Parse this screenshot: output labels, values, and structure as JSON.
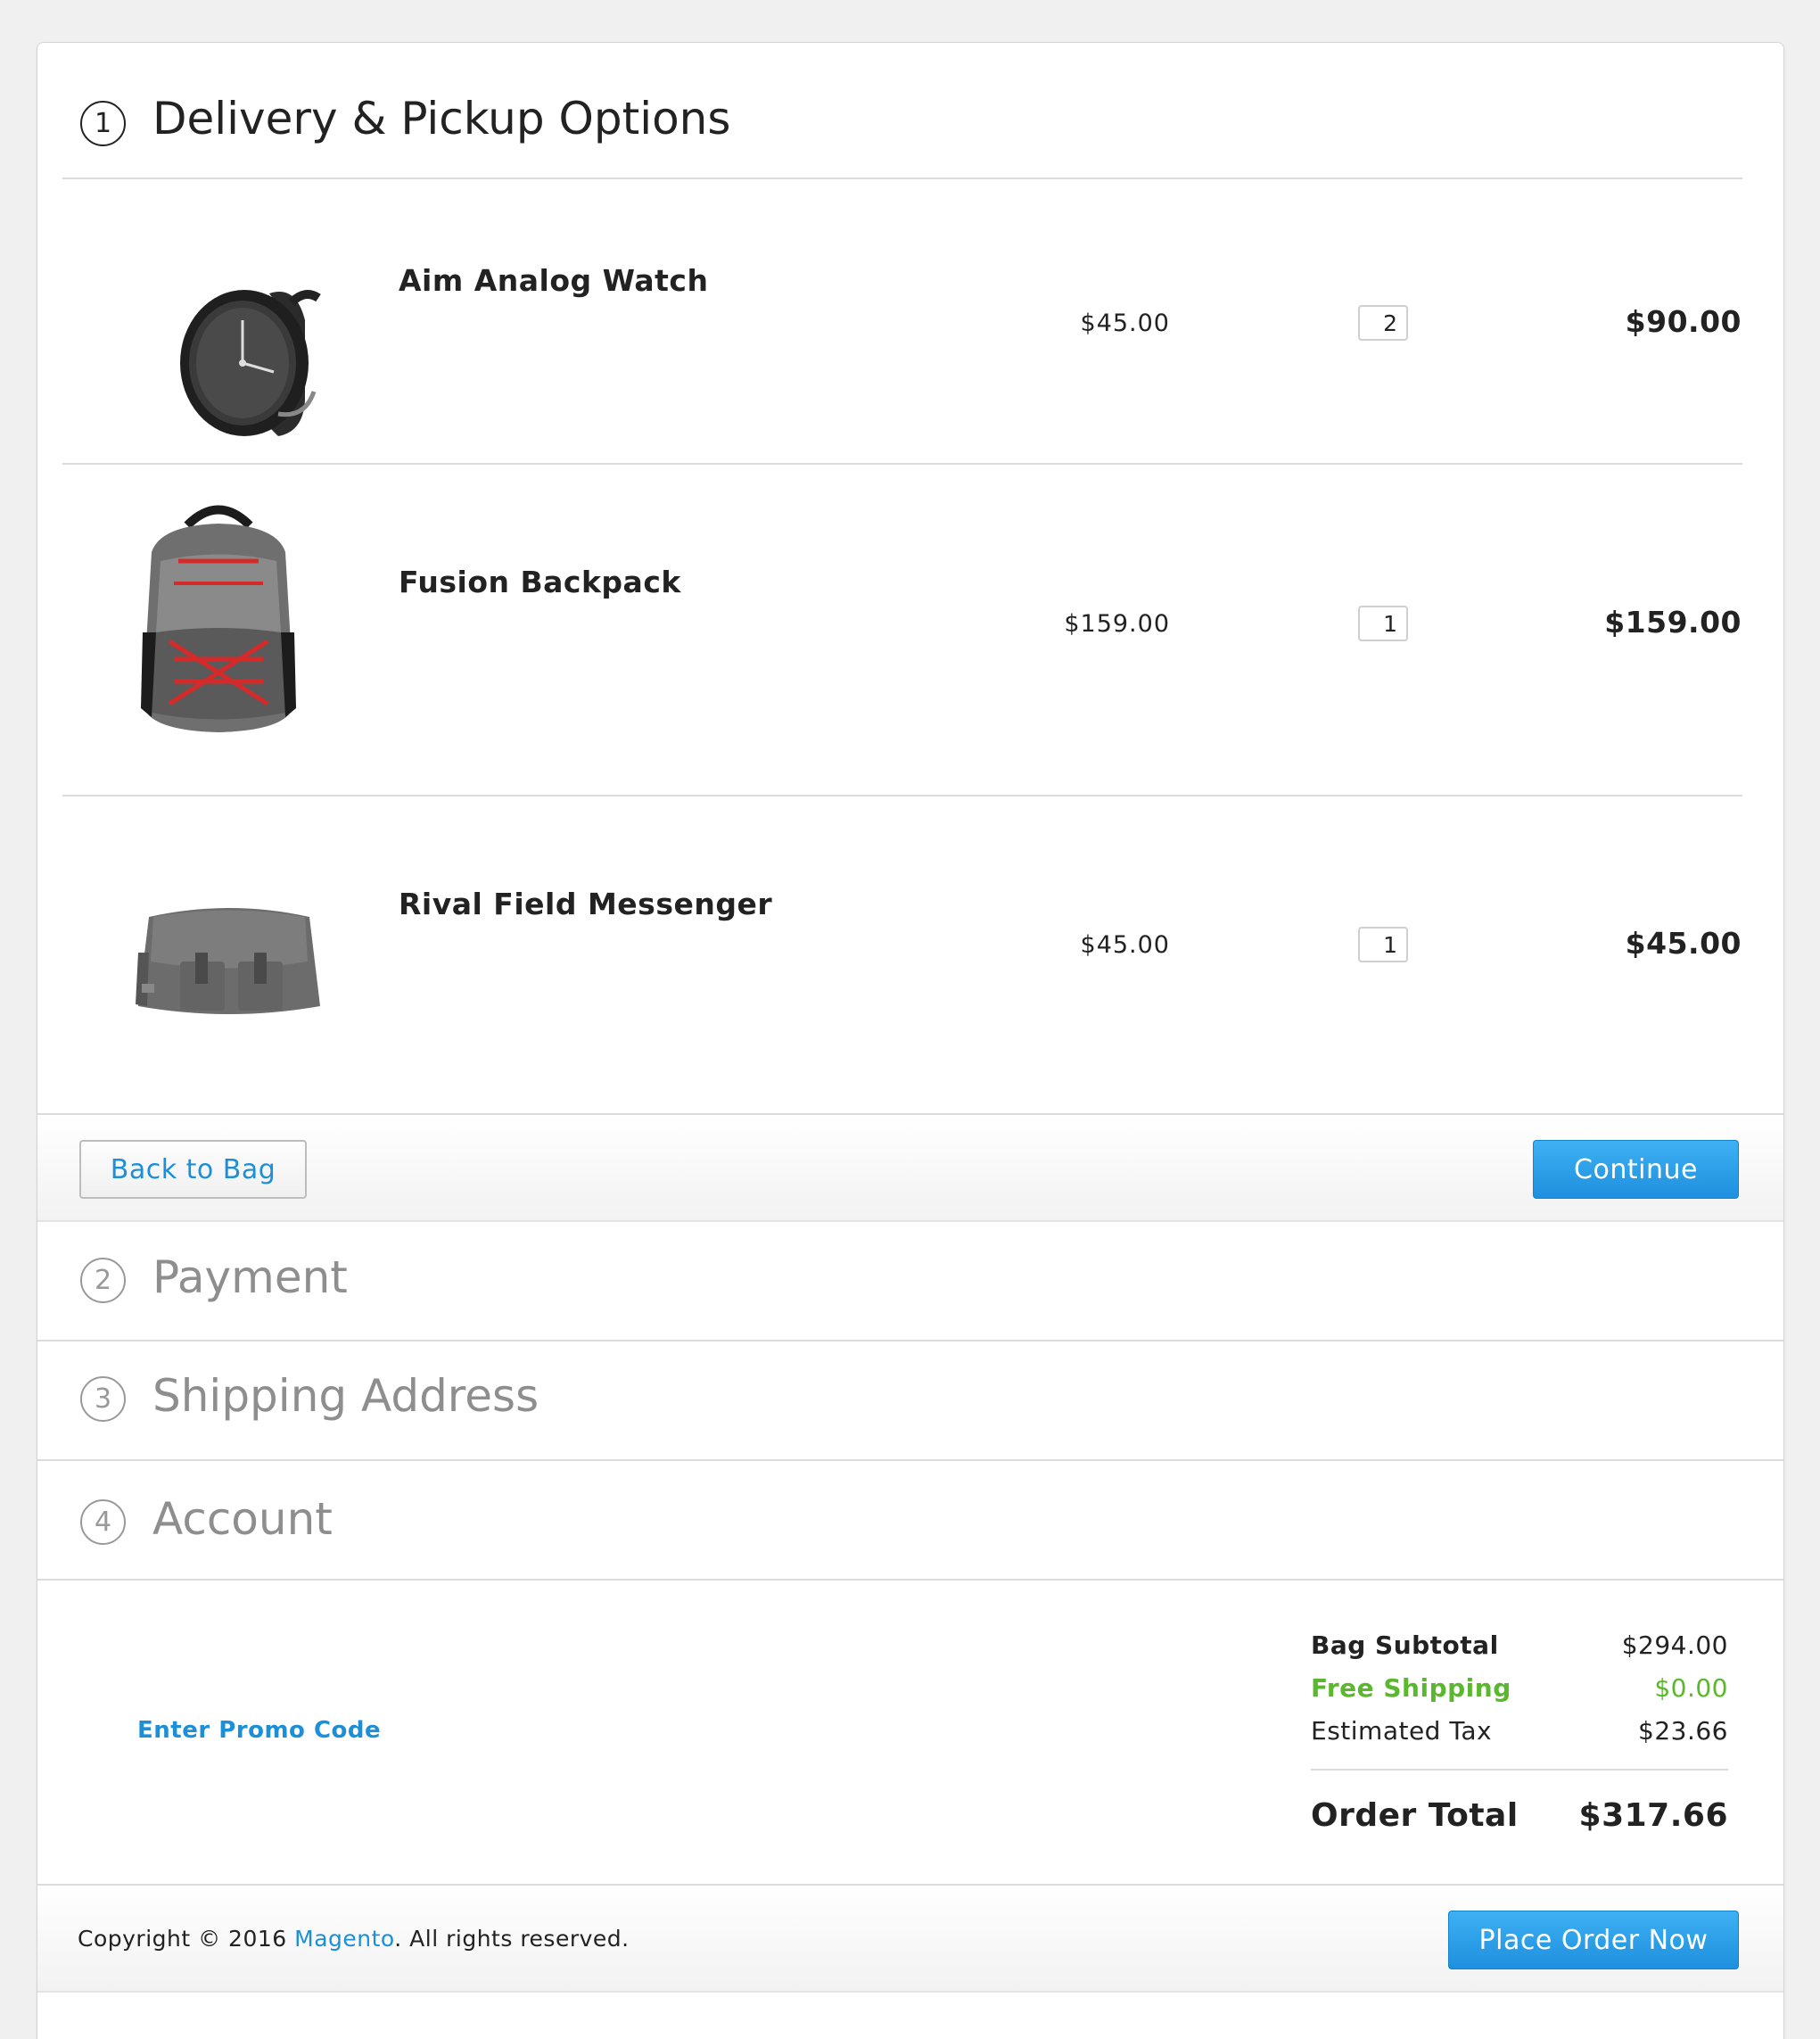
{
  "steps": [
    {
      "number": "1",
      "title": "Delivery & Pickup Options"
    },
    {
      "number": "2",
      "title": "Payment"
    },
    {
      "number": "3",
      "title": "Shipping Address"
    },
    {
      "number": "4",
      "title": "Account"
    }
  ],
  "products": [
    {
      "name": "Aim Analog Watch",
      "price": "$45.00",
      "qty": "2",
      "total": "$90.00"
    },
    {
      "name": "Fusion Backpack",
      "price": "$159.00",
      "qty": "1",
      "total": "$159.00"
    },
    {
      "name": "Rival Field Messenger",
      "price": "$45.00",
      "qty": "1",
      "total": "$45.00"
    }
  ],
  "actions": {
    "back_label": "Back to Bag",
    "continue_label": "Continue",
    "place_order_label": "Place Order Now"
  },
  "promo": {
    "label": "Enter Promo Code"
  },
  "summary": {
    "subtotal_label": "Bag Subtotal",
    "subtotal_value": "$294.00",
    "shipping_label": "Free Shipping",
    "shipping_value": "$0.00",
    "tax_label": "Estimated Tax",
    "tax_value": "$23.66",
    "total_label": "Order Total",
    "total_value": "$317.66"
  },
  "footer": {
    "copyright_prefix": "Copyright © 2016 ",
    "brand_link": "Magento",
    "copyright_suffix": ". All rights reserved."
  },
  "colors": {
    "accent": "#1d8fd6",
    "primary_button": "#27a0e8",
    "free_shipping": "#5bb82e"
  }
}
